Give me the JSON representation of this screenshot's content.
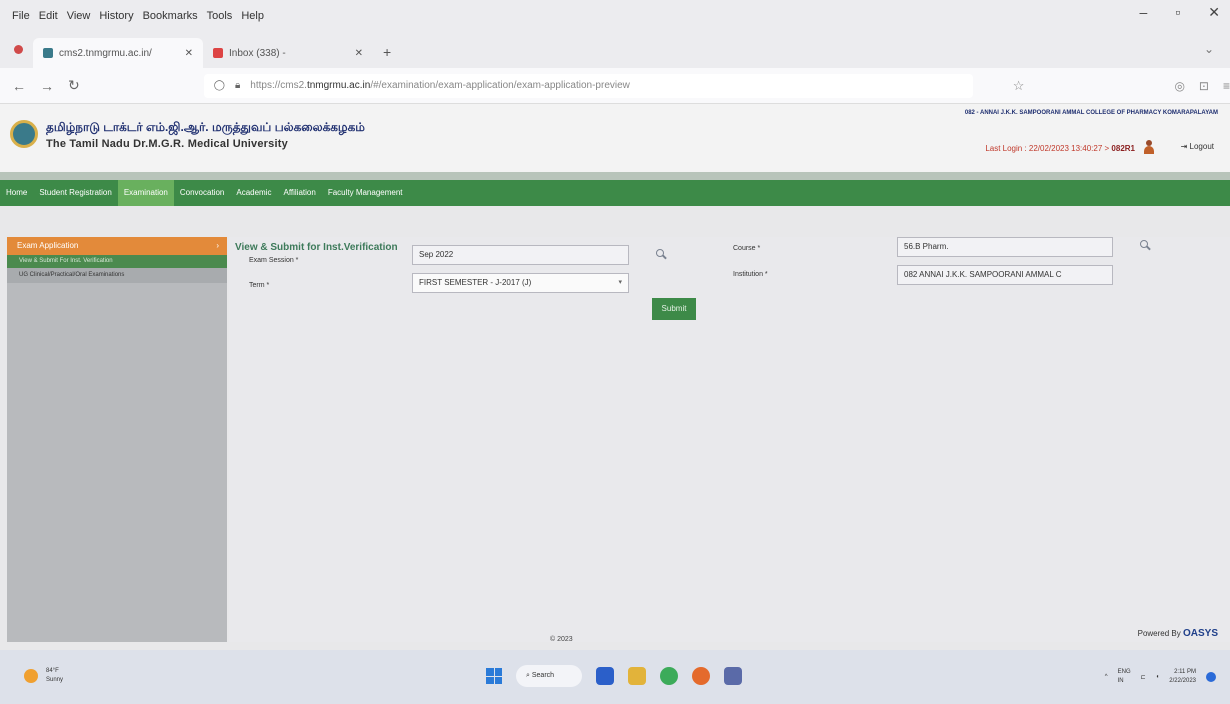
{
  "browser": {
    "menu": [
      "File",
      "Edit",
      "View",
      "History",
      "Bookmarks",
      "Tools",
      "Help"
    ],
    "tabs": [
      {
        "label": "cms2.tnmgrmu.ac.in/",
        "active": true
      },
      {
        "label": "Inbox (338) - ",
        "active": false
      }
    ],
    "url_prefix": "https://cms2.",
    "url_domain": "tnmgrmu.ac.in",
    "url_path": "/#/examination/exam-application/exam-application-preview"
  },
  "site": {
    "university_tamil": "தமிழ்நாடு டாக்டர் எம்.ஜி.ஆர். மருத்துவப் பல்கலைக்கழகம்",
    "university_english": "The Tamil Nadu Dr.M.G.R. Medical University",
    "college_name": "082 - ANNAI J.K.K. SAMPOORANI AMMAL COLLEGE OF PHARMACY KOMARAPALAYAM",
    "last_login_label": "Last Login : 22/02/2023 13:40:27 > ",
    "last_login_user": "082R1",
    "logout_label": "Logout"
  },
  "mainnav": [
    "Home",
    "Student Registration",
    "Examination",
    "Convocation",
    "Academic",
    "Affiliation",
    "Faculty Management"
  ],
  "sidebar": {
    "header": "Exam Application",
    "sub": "View & Submit For Inst. Verification",
    "item": "UG Clinical/Practical/Oral Examinations"
  },
  "page": {
    "title": "View & Submit for Inst.Verification",
    "exam_session_label": "Exam Session *",
    "exam_session_value": "Sep 2022",
    "term_label": "Term *",
    "term_value": "FIRST SEMESTER - J-2017 (J)",
    "course_label": "Course *",
    "course_value": "56.B Pharm.",
    "institution_label": "Institution *",
    "institution_value": "082 ANNAI J.K.K. SAMPOORANI AMMAL C",
    "submit_label": "Submit"
  },
  "footer": {
    "copyright": "© 2023",
    "powered_by": "Powered By",
    "brand": "OASYS"
  },
  "taskbar": {
    "temp": "84°F",
    "weather": "Sunny",
    "search": "Search",
    "lang1": "ENG",
    "lang2": "IN",
    "time": "2:11 PM",
    "date": "2/22/2023"
  }
}
